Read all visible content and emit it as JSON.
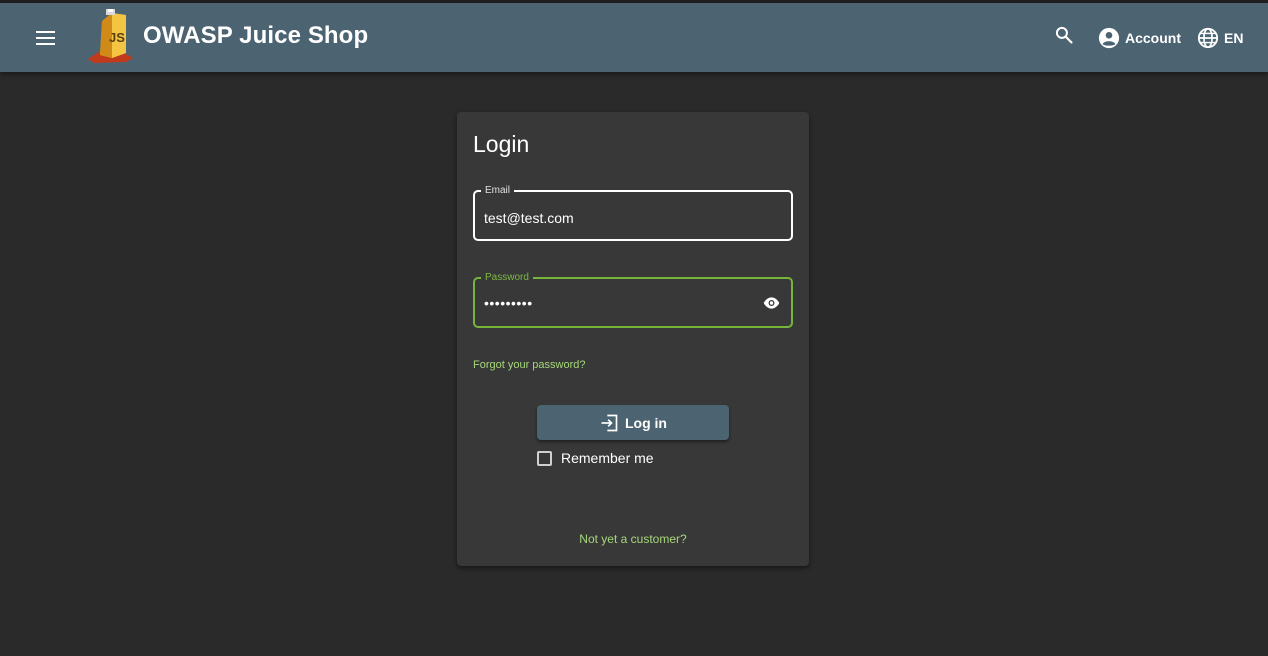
{
  "header": {
    "app_title": "OWASP Juice Shop",
    "account_label": "Account",
    "language_label": "EN",
    "icons": {
      "menu": "menu-icon",
      "logo": "juice-shop-logo",
      "search": "search-icon",
      "account": "account-circle-icon",
      "language": "language-globe-icon"
    }
  },
  "login": {
    "title": "Login",
    "email": {
      "label": "Email",
      "value": "test@test.com"
    },
    "password": {
      "label": "Password",
      "masked_value": "•••••••••"
    },
    "forgot_password_link": "Forgot your password?",
    "login_button_label": "Log in",
    "remember_me_label": "Remember me",
    "remember_me_checked": false,
    "register_link": "Not yet a customer?"
  },
  "colors": {
    "toolbar": "#4c6371",
    "background": "#2a2a2a",
    "card": "#383838",
    "accent_green": "#76b43a",
    "link_green": "#a6d77a"
  }
}
